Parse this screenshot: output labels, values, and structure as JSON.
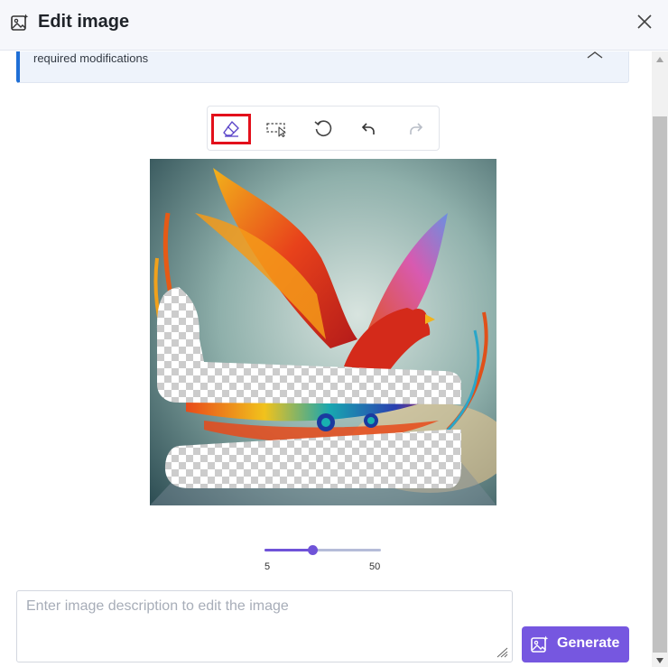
{
  "dialog": {
    "title": "Edit image",
    "title_icon": "image-edit-icon",
    "close_icon": "close-icon"
  },
  "banner": {
    "text": "required modifications",
    "collapse_icon": "chevron-up-icon",
    "accent_color": "#1f6fd6"
  },
  "toolbar": {
    "tools": [
      {
        "name": "eraser",
        "icon": "eraser-icon",
        "active": true
      },
      {
        "name": "select",
        "icon": "rect-select-icon",
        "active": false
      },
      {
        "name": "reset",
        "icon": "rotate-icon",
        "active": false
      },
      {
        "name": "undo",
        "icon": "undo-icon",
        "active": false
      },
      {
        "name": "redo",
        "icon": "redo-icon",
        "active": false,
        "disabled": true
      }
    ],
    "highlight_color": "#e3101b"
  },
  "brush": {
    "min_label": "5",
    "max_label": "50",
    "value": 20,
    "min": 5,
    "max": 50
  },
  "prompt": {
    "placeholder": "Enter image description to edit the image",
    "value": ""
  },
  "generate": {
    "label": "Generate",
    "icon": "image-sparkle-icon",
    "color": "#7657e0"
  },
  "image": {
    "subject": "phoenix-bird-icon"
  }
}
